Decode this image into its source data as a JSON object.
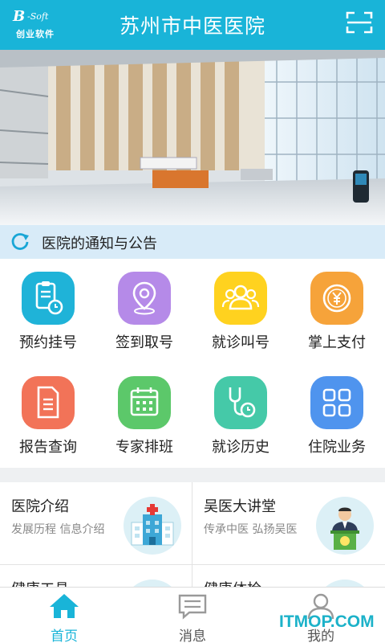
{
  "header": {
    "logo_mark": "B",
    "logo_soft": "-Soft",
    "logo_cn": "创业软件",
    "title": "苏州市中医医院"
  },
  "banner": {
    "carousel_total": 4,
    "carousel_active": 2
  },
  "notice": {
    "label": "医院的通知与公告"
  },
  "grid": [
    {
      "label": "预约挂号",
      "icon": "clipboard-clock-icon",
      "color": "#1fb3d8"
    },
    {
      "label": "签到取号",
      "icon": "location-pin-icon",
      "color": "#b58ae8"
    },
    {
      "label": "就诊叫号",
      "icon": "people-icon",
      "color": "#ffd21f"
    },
    {
      "label": "掌上支付",
      "icon": "yuan-coin-icon",
      "color": "#f6a33a"
    },
    {
      "label": "报告查询",
      "icon": "document-icon",
      "color": "#f27358"
    },
    {
      "label": "专家排班",
      "icon": "calendar-icon",
      "color": "#5cc86a"
    },
    {
      "label": "就诊历史",
      "icon": "stethoscope-clock-icon",
      "color": "#45c9a8"
    },
    {
      "label": "住院业务",
      "icon": "four-squares-icon",
      "color": "#4f94ee"
    }
  ],
  "cards": [
    {
      "title": "医院介绍",
      "subtitle": "发展历程 信息介绍",
      "icon": "hospital-building-icon"
    },
    {
      "title": "吴医大讲堂",
      "subtitle": "传承中医 弘扬吴医",
      "icon": "lecturer-podium-icon"
    },
    {
      "title": "健康工具",
      "subtitle": "",
      "icon": ""
    },
    {
      "title": "健康体检",
      "subtitle": "",
      "icon": ""
    }
  ],
  "bottom_nav": [
    {
      "label": "首页",
      "icon": "home-icon",
      "active": true
    },
    {
      "label": "消息",
      "icon": "message-icon",
      "active": false
    },
    {
      "label": "我的",
      "icon": "user-icon",
      "active": false
    }
  ],
  "watermark": "ITMOP.COM",
  "colors": {
    "accent": "#19b4d8",
    "notice_bg": "#d8ebf8",
    "inactive": "#9a9a9a"
  }
}
